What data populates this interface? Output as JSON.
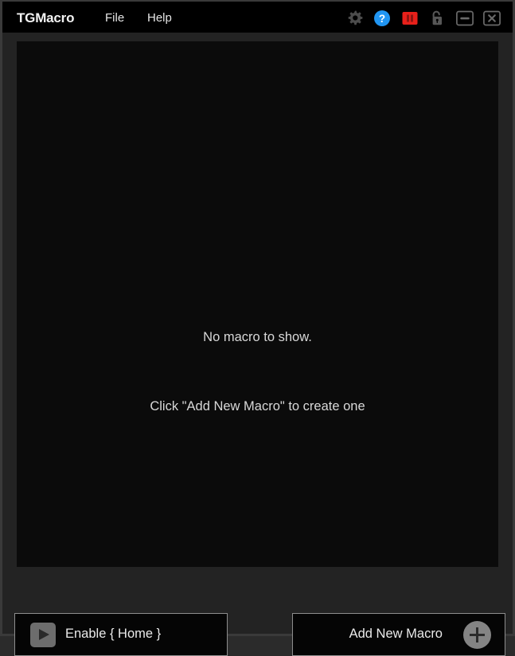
{
  "window": {
    "title": "TGMacro",
    "menu": [
      {
        "label": "File",
        "name": "menu-file"
      },
      {
        "label": "Help",
        "name": "menu-help"
      }
    ],
    "controls": [
      {
        "name": "settings-gear-icon",
        "icon": "gear-icon",
        "color": "#4a4a4a"
      },
      {
        "name": "help-button",
        "icon": "question-circle-icon",
        "color": "#2196f3"
      },
      {
        "name": "pause-button",
        "icon": "pause-icon",
        "color": "#e8201a"
      },
      {
        "name": "lock-toggle",
        "icon": "unlock-icon",
        "color": "#555555"
      },
      {
        "name": "minimize-button",
        "icon": "minimize-icon",
        "color": "#555555"
      },
      {
        "name": "close-button",
        "icon": "close-icon",
        "color": "#555555"
      }
    ]
  },
  "main": {
    "empty_state": {
      "line1": "No macro to show.",
      "line2": "Click \"Add New Macro\" to create one"
    }
  },
  "footer": {
    "enable_button": {
      "label": "Enable { Home }",
      "icon": "play-icon"
    },
    "add_button": {
      "label": "Add New Macro",
      "icon": "plus-icon"
    }
  },
  "colors": {
    "window_frame": "#3a3a3a",
    "titlebar_bg": "#000000",
    "content_bg": "#232323",
    "panel_bg": "#0b0b0b",
    "button_bg": "#050505",
    "button_border": "#8d8d8d",
    "text": "#eaeaea",
    "accent_blue": "#2196f3",
    "accent_red": "#e8201a"
  }
}
